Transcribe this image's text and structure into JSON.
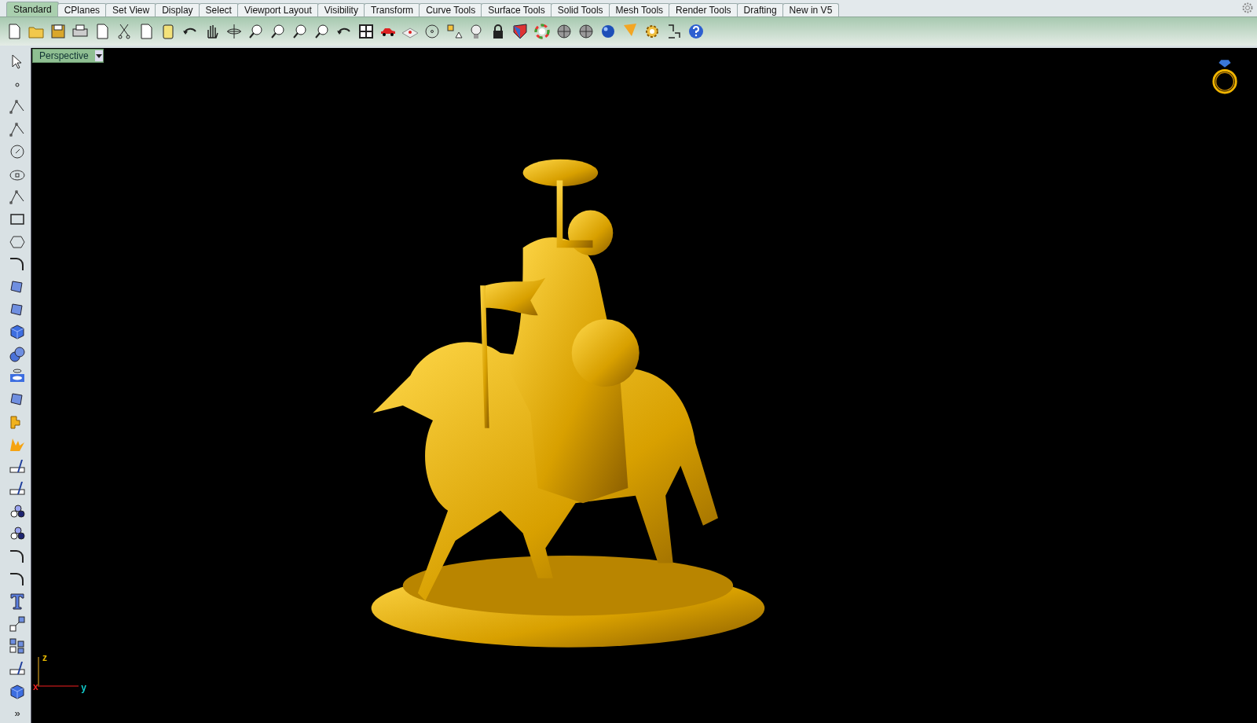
{
  "tabs": [
    {
      "label": "Standard",
      "selected": true
    },
    {
      "label": "CPlanes",
      "selected": false
    },
    {
      "label": "Set View",
      "selected": false
    },
    {
      "label": "Display",
      "selected": false
    },
    {
      "label": "Select",
      "selected": false
    },
    {
      "label": "Viewport Layout",
      "selected": false
    },
    {
      "label": "Visibility",
      "selected": false
    },
    {
      "label": "Transform",
      "selected": false
    },
    {
      "label": "Curve Tools",
      "selected": false
    },
    {
      "label": "Surface Tools",
      "selected": false
    },
    {
      "label": "Solid Tools",
      "selected": false
    },
    {
      "label": "Mesh Tools",
      "selected": false
    },
    {
      "label": "Render Tools",
      "selected": false
    },
    {
      "label": "Drafting",
      "selected": false
    },
    {
      "label": "New in V5",
      "selected": false
    }
  ],
  "left_toolbar": {
    "more": "»"
  },
  "viewport": {
    "title": "Perspective",
    "axes": {
      "x": "x",
      "y": "y",
      "z": "z"
    }
  }
}
